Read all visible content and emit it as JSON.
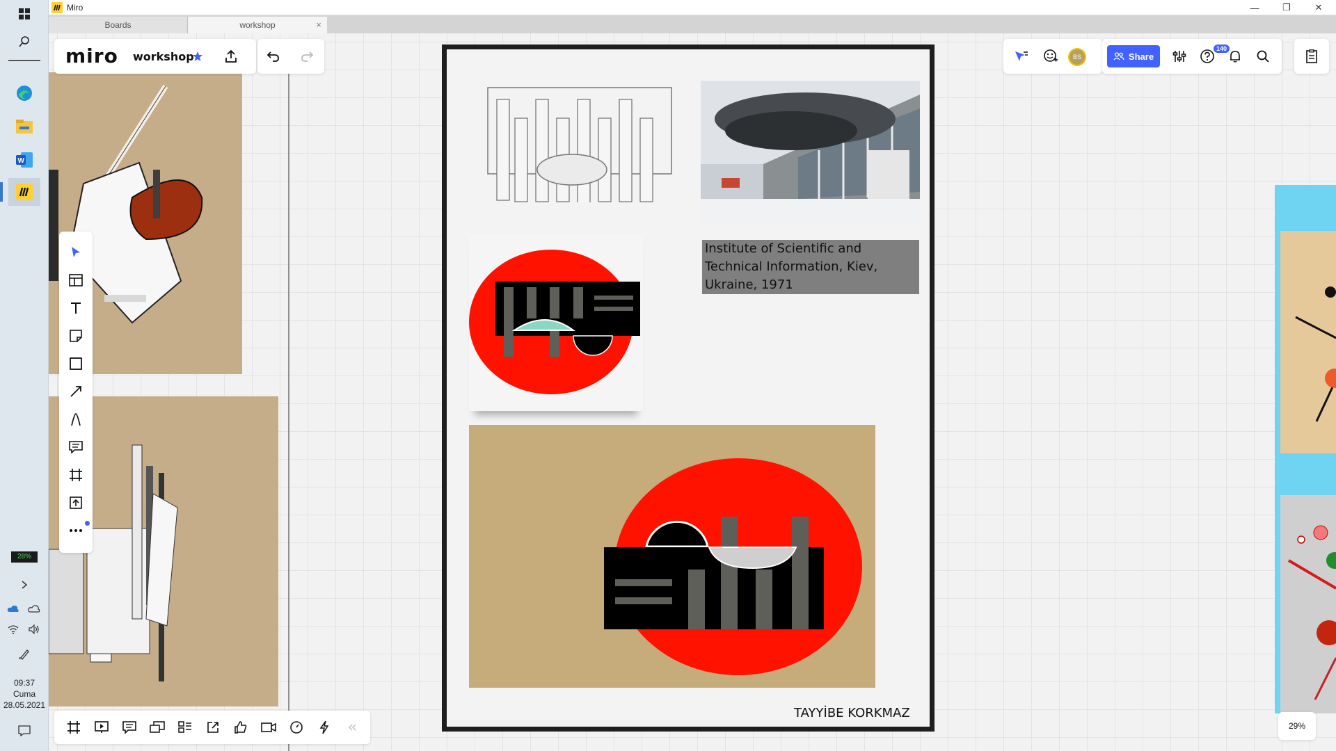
{
  "window": {
    "title": "Miro",
    "controls": {
      "minimize": "—",
      "restore": "❐",
      "close": "✕"
    }
  },
  "tabs": [
    {
      "label": "Boards"
    },
    {
      "label": "workshop",
      "close": "×"
    }
  ],
  "header": {
    "brand": "miro",
    "board_name": "workshop"
  },
  "collab": {
    "avatar_initials": "BS",
    "share_label": "Share",
    "help_badge": "140"
  },
  "taskbar": {
    "battery": "28%",
    "time": "09:37",
    "day": "Cuma",
    "date": "28.05.2021"
  },
  "board": {
    "caption": "Institute of Scientific and Technical Information,  Kiev, Ukraine, 1971",
    "author": "TAYYİBE KORKMAZ"
  },
  "zoom": {
    "level": "29%"
  },
  "colors": {
    "accent": "#4262ff",
    "kraft": "#c6ad8a",
    "red": "#ff1200",
    "frame": "#1e1e1e"
  }
}
